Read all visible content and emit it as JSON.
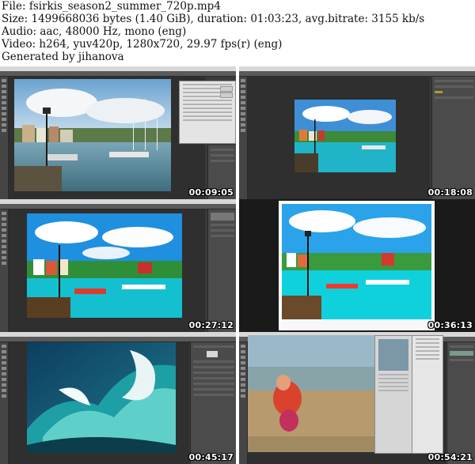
{
  "header": {
    "file": "File: fsirkis_season2_summer_720p.mp4",
    "size": "Size: 1499668036 bytes (1.40 GiB), duration: 01:03:23, avg.bitrate: 3155 kb/s",
    "audio": "Audio: aac, 48000 Hz, mono (eng)",
    "video": "Video: h264, yuv420p, 1280x720, 29.97 fps(r) (eng)",
    "generated": "Generated by jihanova"
  },
  "thumbnails": [
    {
      "timestamp": "00:09:05"
    },
    {
      "timestamp": "00:18:08"
    },
    {
      "timestamp": "00:27:12"
    },
    {
      "timestamp": "00:36:13"
    },
    {
      "timestamp": "00:45:17"
    },
    {
      "timestamp": "00:54:21"
    }
  ]
}
